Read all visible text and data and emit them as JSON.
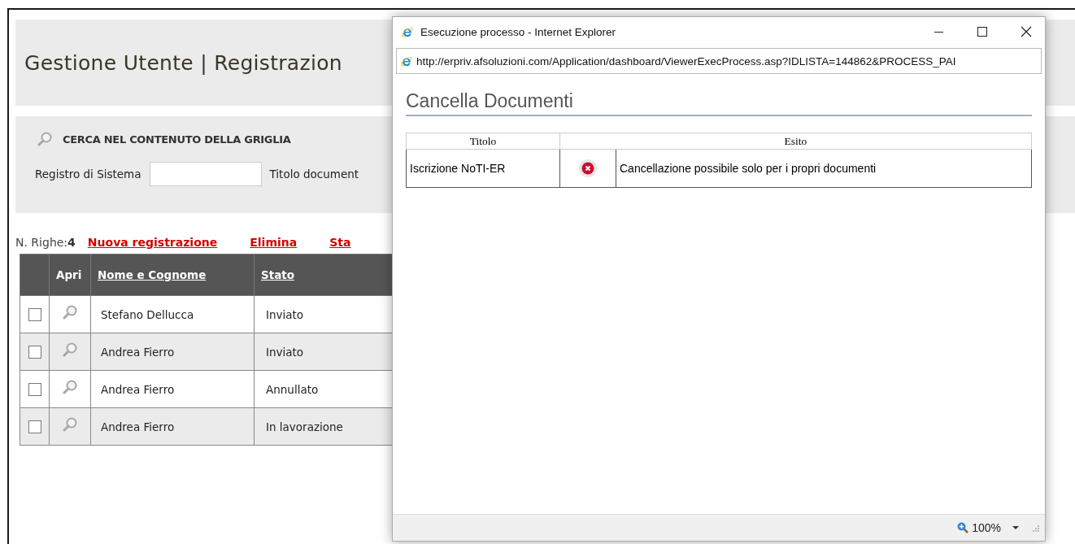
{
  "page": {
    "title": "Gestione Utente | Registrazion",
    "search": {
      "heading": "CERCA NEL CONTENUTO DELLA GRIGLIA",
      "fields": [
        {
          "label": "Registro di Sistema",
          "kind": "input"
        },
        {
          "label": "Titolo document",
          "kind": "label"
        }
      ]
    },
    "toolbar": {
      "count_label": "N. Righe:",
      "count": "4",
      "actions": [
        "Nuova registrazione",
        "Elimina",
        "Sta"
      ]
    },
    "table": {
      "columns": [
        "Apri",
        "Nome e Cognome",
        "Stato"
      ],
      "rows": [
        {
          "checked": false,
          "name": "Stefano Dellucca",
          "status": "Inviato"
        },
        {
          "checked": false,
          "name": "Andrea Fierro",
          "status": "Inviato"
        },
        {
          "checked": false,
          "name": "Andrea Fierro",
          "status": "Annullato"
        },
        {
          "checked": false,
          "name": "Andrea Fierro",
          "status": "In lavorazione"
        }
      ]
    }
  },
  "popup": {
    "title": "Esecuzione processo - Internet Explorer",
    "url": "http://erpriv.afsoluzioni.com/Application/dashboard/ViewerExecProcess.asp?IDLISTA=144862&PROCESS_PAI",
    "heading": "Cancella Documenti",
    "columns": [
      "Titolo",
      "Esito"
    ],
    "rows": [
      {
        "titolo": "Iscrizione NoTI-ER",
        "kind": "error",
        "esito": "Cancellazione possibile solo per i propri documenti"
      }
    ],
    "status_bar": {
      "zoom": "100%"
    }
  }
}
